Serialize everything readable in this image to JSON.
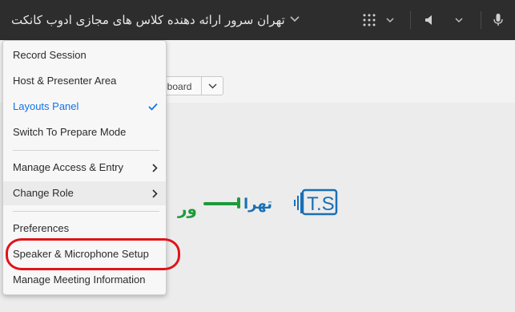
{
  "header": {
    "title": "تهران سرور ارائه دهنده کلاس های مجازی ادوب کانکت",
    "title_menu_icon": "chevron-down-icon",
    "layout_grid_icon": "grid-icon",
    "speaker_icon": "speaker-icon",
    "mic_icon": "microphone-icon"
  },
  "toolbar": {
    "whiteboard_label": "eboard"
  },
  "menu": {
    "items": [
      {
        "label": "Record Session"
      },
      {
        "label": "Host & Presenter Area"
      },
      {
        "label": "Layouts Panel",
        "checked": true
      },
      {
        "label": "Switch To Prepare Mode"
      },
      {
        "label": "Manage Access & Entry",
        "submenu": true
      },
      {
        "label": "Change Role",
        "submenu": true
      },
      {
        "label": "Preferences"
      },
      {
        "label": "Speaker & Microphone Setup"
      },
      {
        "label": "Manage Meeting Information"
      }
    ]
  },
  "logo": {
    "badge_text": "T.S",
    "wordmark": "تهران سرور"
  },
  "colors": {
    "topbar": "#2d2d2d",
    "accent": "#1473e6",
    "annotation": "#e0141b",
    "logo_blue": "#1a6fb5",
    "logo_green": "#1e9a3a"
  }
}
